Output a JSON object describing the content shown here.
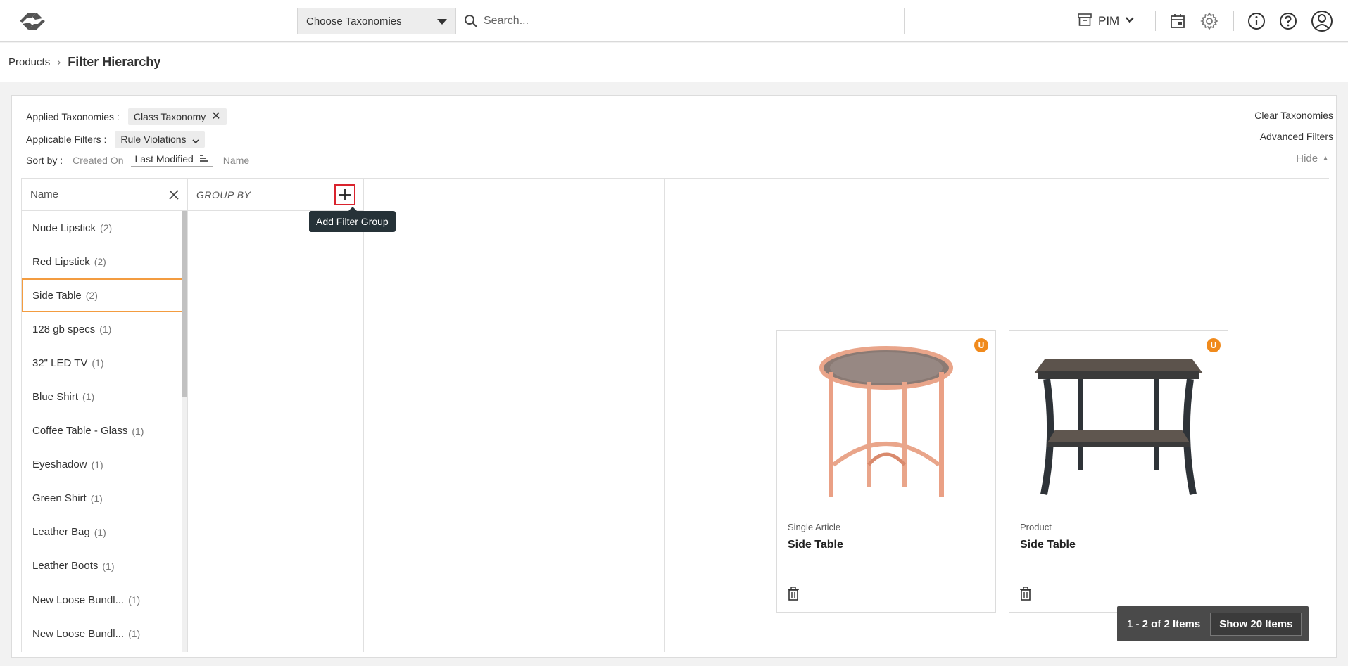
{
  "header": {
    "taxonomy_select": "Choose Taxonomies",
    "search_placeholder": "Search...",
    "workspace": "PIM"
  },
  "breadcrumb": {
    "parent": "Products",
    "current": "Filter Hierarchy"
  },
  "filters": {
    "applied_label": "Applied Taxonomies :",
    "applied_chip": "Class Taxonomy",
    "applicable_label": "Applicable Filters :",
    "applicable_chip": "Rule Violations",
    "sort_label": "Sort by :",
    "sort_created": "Created On",
    "sort_modified": "Last Modified",
    "sort_name": "Name",
    "clear_taxonomies": "Clear Taxonomies",
    "advanced_filters": "Advanced Filters",
    "hide": "Hide"
  },
  "list": {
    "header": "Name",
    "items": [
      {
        "name": "Nude Lipstick",
        "count": "(2)"
      },
      {
        "name": "Red Lipstick",
        "count": "(2)"
      },
      {
        "name": "Side Table",
        "count": "(2)"
      },
      {
        "name": "128 gb specs",
        "count": "(1)"
      },
      {
        "name": "32\" LED TV",
        "count": "(1)"
      },
      {
        "name": "Blue Shirt",
        "count": "(1)"
      },
      {
        "name": "Coffee Table - Glass",
        "count": "(1)"
      },
      {
        "name": "Eyeshadow",
        "count": "(1)"
      },
      {
        "name": "Green Shirt",
        "count": "(1)"
      },
      {
        "name": "Leather Bag",
        "count": "(1)"
      },
      {
        "name": "Leather Boots",
        "count": "(1)"
      },
      {
        "name": "New Loose Bundl...",
        "count": "(1)"
      },
      {
        "name": "New Loose Bundl...",
        "count": "(1)"
      }
    ]
  },
  "group": {
    "header": "GROUP BY",
    "tooltip": "Add Filter Group"
  },
  "cards": [
    {
      "badge": "U",
      "type": "Single Article",
      "name": "Side Table"
    },
    {
      "badge": "U",
      "type": "Product",
      "name": "Side Table"
    }
  ],
  "pager": {
    "info": "1 - 2 of 2 Items",
    "show": "Show 20 Items"
  },
  "colors": {
    "accent": "#f39c40",
    "badge": "#f08a1c",
    "highlight": "#d9232d",
    "tooltip_bg": "#263238"
  }
}
